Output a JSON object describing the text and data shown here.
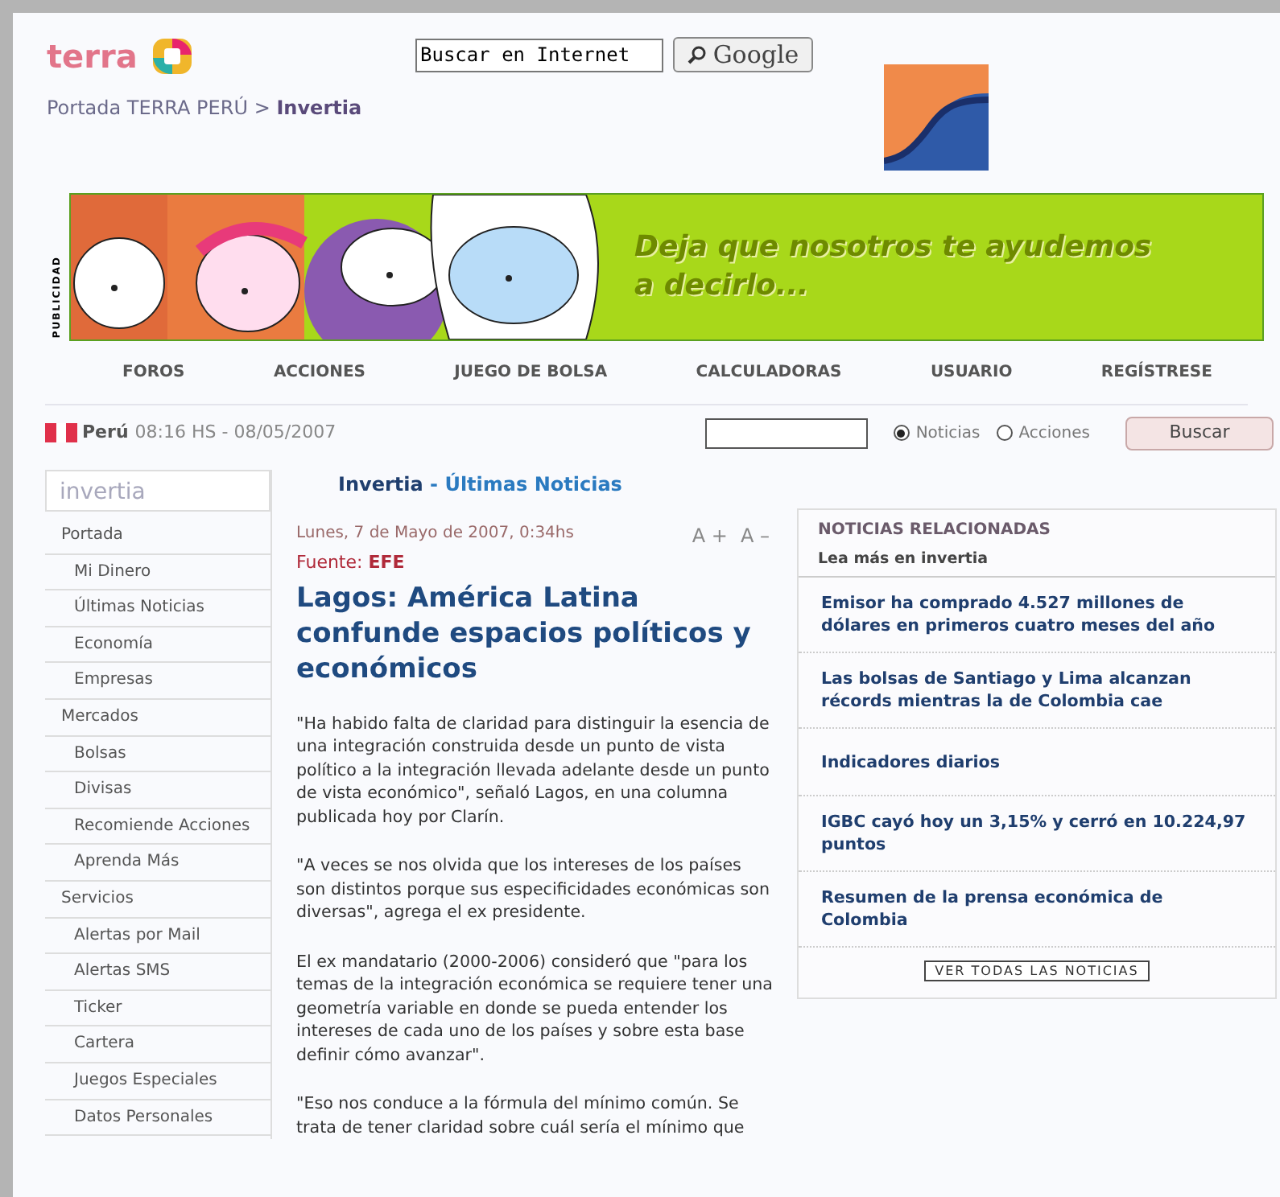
{
  "header": {
    "logo": "terra",
    "search": {
      "value": "Buscar en Internet",
      "button": "Google"
    },
    "breadcrumb": {
      "parent": "Portada TERRA PERÚ",
      "separator": ">",
      "current": "Invertia"
    }
  },
  "ad": {
    "label": "PUBLICIDAD",
    "lines": [
      "Deja que nosotros te ayudemos",
      "a decirlo..."
    ]
  },
  "nav": [
    "FOROS",
    "ACCIONES",
    "JUEGO DE BOLSA",
    "CALCULADORAS",
    "USUARIO",
    "REGÍSTRESE"
  ],
  "date_bar": {
    "country": "Perú",
    "time": "08:16 HS - 08/05/2007",
    "radios": [
      {
        "label": "Noticias",
        "selected": true
      },
      {
        "label": "Acciones",
        "selected": false
      }
    ],
    "button": "Buscar"
  },
  "sidebar": {
    "title": "invertia",
    "items": [
      {
        "label": "Portada",
        "children": [
          {
            "label": "Mi Dinero"
          },
          {
            "label": "Últimas Noticias"
          },
          {
            "label": "Economía"
          },
          {
            "label": "Empresas"
          }
        ]
      },
      {
        "label": "Mercados",
        "children": [
          {
            "label": "Bolsas"
          },
          {
            "label": "Divisas"
          },
          {
            "label": "Recomiende Acciones"
          },
          {
            "label": "Aprenda Más"
          }
        ]
      },
      {
        "label": "Servicios",
        "children": [
          {
            "label": "Alertas por Mail"
          },
          {
            "label": "Alertas SMS"
          },
          {
            "label": "Ticker"
          },
          {
            "label": "Cartera"
          },
          {
            "label": "Juegos Especiales"
          },
          {
            "label": "Datos Personales"
          }
        ]
      }
    ]
  },
  "section_title": {
    "brand": "Invertia",
    "separator": "-",
    "section": "Últimas Noticias"
  },
  "article": {
    "date": "Lunes, 7 de Mayo de 2007, 0:34hs",
    "source_label": "Fuente:",
    "source": "EFE",
    "font_controls": [
      "A +",
      "A –"
    ],
    "headline": "Lagos: América Latina confunde espacios políticos y económicos",
    "paragraphs": [
      "\"Ha habido falta de claridad para distinguir la esencia de una integración construida desde un punto de vista político a la integración llevada adelante desde un punto de vista económico\", señaló Lagos, en una columna publicada hoy por Clarín.",
      "\"A veces se nos olvida que los intereses de los países son distintos porque sus especificidades económicas son diversas\", agrega el ex presidente.",
      "El ex mandatario (2000-2006) consideró que \"para los temas de la integración económica se requiere tener una geometría variable en donde se pueda entender los intereses de cada uno de los países y sobre esta base definir cómo avanzar\".",
      "\"Eso nos conduce a la fórmula del mínimo común. Se trata de tener claridad sobre cuál sería el mínimo que"
    ]
  },
  "related": {
    "title": "NOTICIAS RELACIONADAS",
    "subtitle": "Lea más en invertia",
    "items": [
      "Emisor ha comprado 4.527 millones de dólares en primeros cuatro meses del año",
      "Las bolsas de Santiago y Lima alcanzan récords mientras la de Colombia cae",
      "Indicadores diarios",
      "IGBC cayó hoy un 3,15% y cerró en 10.224,97 puntos",
      "Resumen de la prensa económica de Colombia"
    ],
    "button": "VER TODAS LAS NOTICIAS"
  }
}
